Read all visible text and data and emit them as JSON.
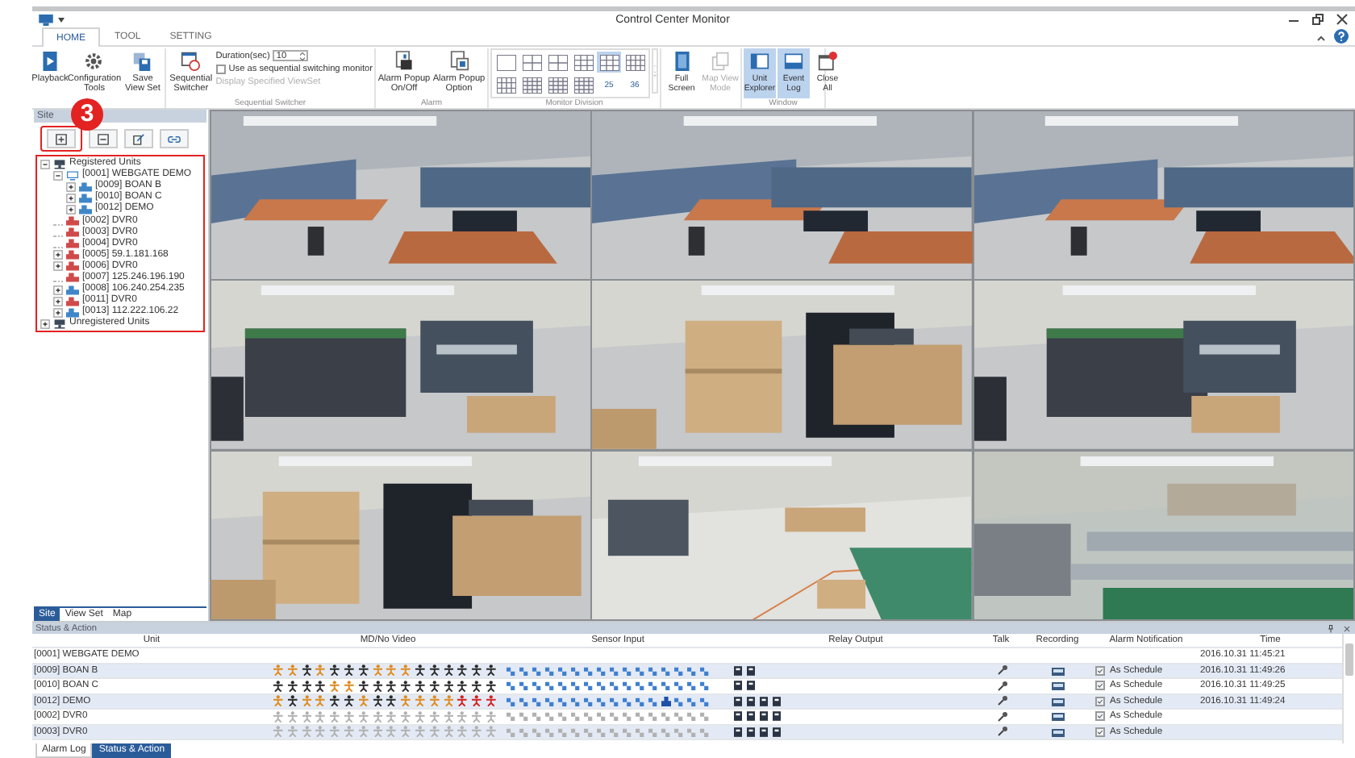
{
  "window": {
    "title": "Control Center Monitor"
  },
  "tabs": [
    {
      "label": "HOME",
      "selected": true
    },
    {
      "label": "TOOL",
      "selected": false
    },
    {
      "label": "SETTING",
      "selected": false
    }
  ],
  "ribbon": {
    "main_buttons": [
      {
        "label": "Playback"
      },
      {
        "label": "Configuration Tools"
      },
      {
        "label": "Save View Set"
      }
    ],
    "sequential": {
      "caption": "Sequential Switcher",
      "button": "Sequential Switcher",
      "duration_label": "Duration(sec)",
      "duration_value": "10",
      "loop_checkbox": {
        "label": "Use as sequential switching monitor",
        "checked": false
      },
      "viewset_option": {
        "label": "Display Specified ViewSet",
        "disabled": true
      }
    },
    "alarm": {
      "caption": "Alarm",
      "buttons": [
        {
          "label": "Alarm Popup On/Off"
        },
        {
          "label": "Alarm Popup Option"
        }
      ]
    },
    "monitor_division": {
      "caption": "Monitor Division",
      "layouts": [
        {
          "selected": false
        },
        {
          "selected": false
        },
        {
          "selected": false
        },
        {
          "selected": false
        },
        {
          "selected": true
        },
        {
          "selected": false
        },
        {
          "selected": false
        },
        {
          "selected": false
        },
        {
          "selected": false
        },
        {
          "selected": false
        },
        {
          "label": "25",
          "selected": false
        },
        {
          "label": "36",
          "selected": false
        }
      ]
    },
    "view_buttons": [
      {
        "label": "Full Screen",
        "disabled": false
      },
      {
        "label": "Map View Mode",
        "disabled": true
      }
    ],
    "window_group": {
      "caption": "Window",
      "buttons": [
        {
          "label": "Unit Explorer",
          "selected": true
        },
        {
          "label": "Event Log",
          "selected": true
        },
        {
          "label": "Close All",
          "selected": false
        }
      ]
    }
  },
  "sidebar": {
    "title": "Site",
    "annotation": "3",
    "tree": [
      {
        "label": "Registered Units",
        "kind": "group",
        "expanded": true,
        "children": [
          {
            "label": "[0001] WEBGATE DEMO",
            "kind": "site",
            "expanded": true,
            "children": [
              {
                "label": "[0009] BOAN B",
                "kind": "unit",
                "color": "#3f86c8",
                "expanded": false
              },
              {
                "label": "[0010] BOAN C",
                "kind": "unit",
                "color": "#3f86c8",
                "expanded": false
              },
              {
                "label": "[0012] DEMO",
                "kind": "unit",
                "color": "#3f86c8",
                "expanded": false
              }
            ]
          },
          {
            "label": "[0002] DVR0",
            "kind": "unit",
            "color": "#d04a4a"
          },
          {
            "label": "[0003] DVR0",
            "kind": "unit",
            "color": "#d04a4a"
          },
          {
            "label": "[0004] DVR0",
            "kind": "unit",
            "color": "#d04a4a"
          },
          {
            "label": "[0005] 59.1.181.168",
            "kind": "unit",
            "color": "#d04a4a",
            "expanded": false
          },
          {
            "label": "[0006] DVR0",
            "kind": "unit",
            "color": "#d04a4a",
            "expanded": false
          },
          {
            "label": "[0007] 125.246.196.190",
            "kind": "unit",
            "color": "#d04a4a"
          },
          {
            "label": "[0008] 106.240.254.235",
            "kind": "unit",
            "color": "#3f86c8",
            "expanded": false
          },
          {
            "label": "[0011] DVR0",
            "kind": "unit",
            "color": "#d04a4a",
            "expanded": false
          },
          {
            "label": "[0013] 112.222.106.22",
            "kind": "unit",
            "color": "#3f86c8",
            "expanded": false
          }
        ]
      },
      {
        "label": "Unregistered Units",
        "kind": "group",
        "expanded": false
      }
    ],
    "tabs": [
      {
        "label": "Site",
        "selected": true
      },
      {
        "label": "View Set",
        "selected": false
      },
      {
        "label": "Map",
        "selected": false
      }
    ]
  },
  "status_panel": {
    "title": "Status & Action",
    "columns": [
      "Unit",
      "MD/No Video",
      "Sensor Input",
      "Relay Output",
      "Talk",
      "Recording",
      "Alarm Notification",
      "Time"
    ],
    "rows": [
      {
        "kind": "site",
        "unit": "[0001] WEBGATE DEMO",
        "time": "2016.10.31 11:45:21"
      },
      {
        "kind": "unit",
        "unit": "[0009] BOAN B",
        "md": [
          {
            "kind": "motion"
          },
          {
            "kind": "motion"
          },
          {
            "kind": "idle"
          },
          {
            "kind": "motion"
          },
          {
            "kind": "idle"
          },
          {
            "kind": "idle"
          },
          {
            "kind": "idle"
          },
          {
            "kind": "motion"
          },
          {
            "kind": "motion"
          },
          {
            "kind": "motion"
          },
          {
            "kind": "idle"
          },
          {
            "kind": "idle"
          },
          {
            "kind": "idle"
          },
          {
            "kind": "idle"
          },
          {
            "kind": "idle"
          },
          {
            "kind": "idle"
          }
        ],
        "sensors": [
          {
            "kind": "normal"
          },
          {
            "kind": "normal"
          },
          {
            "kind": "normal"
          },
          {
            "kind": "normal"
          },
          {
            "kind": "normal"
          },
          {
            "kind": "normal"
          },
          {
            "kind": "normal"
          },
          {
            "kind": "normal"
          },
          {
            "kind": "normal"
          },
          {
            "kind": "normal"
          },
          {
            "kind": "normal"
          },
          {
            "kind": "normal"
          },
          {
            "kind": "normal"
          },
          {
            "kind": "normal"
          },
          {
            "kind": "normal"
          },
          {
            "kind": "normal"
          }
        ],
        "relays": [
          {
            "kind": "normal"
          },
          {
            "kind": "normal"
          }
        ],
        "notification": {
          "checked": true,
          "label": "As Schedule"
        },
        "time": "2016.10.31 11:49:26"
      },
      {
        "kind": "unit",
        "unit": "[0010] BOAN C",
        "md": [
          {
            "kind": "idle"
          },
          {
            "kind": "idle"
          },
          {
            "kind": "idle"
          },
          {
            "kind": "idle"
          },
          {
            "kind": "motion"
          },
          {
            "kind": "motion"
          },
          {
            "kind": "idle"
          },
          {
            "kind": "idle"
          },
          {
            "kind": "idle"
          },
          {
            "kind": "idle"
          },
          {
            "kind": "idle"
          },
          {
            "kind": "idle"
          },
          {
            "kind": "idle"
          },
          {
            "kind": "idle"
          },
          {
            "kind": "idle"
          },
          {
            "kind": "idle"
          }
        ],
        "sensors": [
          {
            "kind": "normal"
          },
          {
            "kind": "normal"
          },
          {
            "kind": "normal"
          },
          {
            "kind": "normal"
          },
          {
            "kind": "normal"
          },
          {
            "kind": "normal"
          },
          {
            "kind": "normal"
          },
          {
            "kind": "normal"
          },
          {
            "kind": "normal"
          },
          {
            "kind": "normal"
          },
          {
            "kind": "normal"
          },
          {
            "kind": "normal"
          },
          {
            "kind": "normal"
          },
          {
            "kind": "normal"
          },
          {
            "kind": "normal"
          },
          {
            "kind": "normal"
          }
        ],
        "relays": [
          {
            "kind": "normal"
          },
          {
            "kind": "normal"
          }
        ],
        "notification": {
          "checked": true,
          "label": "As Schedule"
        },
        "time": "2016.10.31 11:49:25"
      },
      {
        "kind": "unit",
        "unit": "[0012] DEMO",
        "md": [
          {
            "kind": "motion"
          },
          {
            "kind": "idle"
          },
          {
            "kind": "motion"
          },
          {
            "kind": "motion"
          },
          {
            "kind": "idle"
          },
          {
            "kind": "idle"
          },
          {
            "kind": "motion"
          },
          {
            "kind": "idle"
          },
          {
            "kind": "idle"
          },
          {
            "kind": "motion"
          },
          {
            "kind": "motion"
          },
          {
            "kind": "motion"
          },
          {
            "kind": "motion"
          },
          {
            "kind": "no_video"
          },
          {
            "kind": "no_video"
          },
          {
            "kind": "no_video"
          }
        ],
        "sensors": [
          {
            "kind": "normal"
          },
          {
            "kind": "normal"
          },
          {
            "kind": "normal"
          },
          {
            "kind": "normal"
          },
          {
            "kind": "normal"
          },
          {
            "kind": "normal"
          },
          {
            "kind": "normal"
          },
          {
            "kind": "normal"
          },
          {
            "kind": "normal"
          },
          {
            "kind": "normal"
          },
          {
            "kind": "normal"
          },
          {
            "kind": "normal"
          },
          {
            "kind": "alarm"
          },
          {
            "kind": "normal"
          },
          {
            "kind": "normal"
          },
          {
            "kind": "normal"
          }
        ],
        "relays": [
          {
            "kind": "normal"
          },
          {
            "kind": "normal"
          },
          {
            "kind": "normal"
          },
          {
            "kind": "normal"
          }
        ],
        "notification": {
          "checked": true,
          "label": "As Schedule"
        },
        "time": "2016.10.31 11:49:24"
      },
      {
        "kind": "unit",
        "unit": "[0002] DVR0",
        "md": [
          {
            "kind": "offline"
          },
          {
            "kind": "offline"
          },
          {
            "kind": "offline"
          },
          {
            "kind": "offline"
          },
          {
            "kind": "offline"
          },
          {
            "kind": "offline"
          },
          {
            "kind": "offline"
          },
          {
            "kind": "offline"
          },
          {
            "kind": "offline"
          },
          {
            "kind": "offline"
          },
          {
            "kind": "offline"
          },
          {
            "kind": "offline"
          },
          {
            "kind": "offline"
          },
          {
            "kind": "offline"
          },
          {
            "kind": "offline"
          },
          {
            "kind": "offline"
          }
        ],
        "sensors": [
          {
            "kind": "offline"
          },
          {
            "kind": "offline"
          },
          {
            "kind": "offline"
          },
          {
            "kind": "offline"
          },
          {
            "kind": "offline"
          },
          {
            "kind": "offline"
          },
          {
            "kind": "offline"
          },
          {
            "kind": "offline"
          },
          {
            "kind": "offline"
          },
          {
            "kind": "offline"
          },
          {
            "kind": "offline"
          },
          {
            "kind": "offline"
          },
          {
            "kind": "offline"
          },
          {
            "kind": "offline"
          },
          {
            "kind": "offline"
          },
          {
            "kind": "offline"
          }
        ],
        "relays": [
          {
            "kind": "normal"
          },
          {
            "kind": "normal"
          },
          {
            "kind": "normal"
          },
          {
            "kind": "normal"
          }
        ],
        "notification": {
          "checked": true,
          "label": "As Schedule"
        }
      },
      {
        "kind": "unit",
        "unit": "[0003] DVR0",
        "md": [
          {
            "kind": "offline"
          },
          {
            "kind": "offline"
          },
          {
            "kind": "offline"
          },
          {
            "kind": "offline"
          },
          {
            "kind": "offline"
          },
          {
            "kind": "offline"
          },
          {
            "kind": "offline"
          },
          {
            "kind": "offline"
          },
          {
            "kind": "offline"
          },
          {
            "kind": "offline"
          },
          {
            "kind": "offline"
          },
          {
            "kind": "offline"
          },
          {
            "kind": "offline"
          },
          {
            "kind": "offline"
          },
          {
            "kind": "offline"
          },
          {
            "kind": "offline"
          }
        ],
        "sensors": [
          {
            "kind": "offline"
          },
          {
            "kind": "offline"
          },
          {
            "kind": "offline"
          },
          {
            "kind": "offline"
          },
          {
            "kind": "offline"
          },
          {
            "kind": "offline"
          },
          {
            "kind": "offline"
          },
          {
            "kind": "offline"
          },
          {
            "kind": "offline"
          },
          {
            "kind": "offline"
          },
          {
            "kind": "offline"
          },
          {
            "kind": "offline"
          },
          {
            "kind": "offline"
          },
          {
            "kind": "offline"
          },
          {
            "kind": "offline"
          },
          {
            "kind": "offline"
          }
        ],
        "relays": [
          {
            "kind": "normal"
          },
          {
            "kind": "normal"
          },
          {
            "kind": "normal"
          },
          {
            "kind": "normal"
          }
        ],
        "notification": {
          "checked": true,
          "label": "As Schedule"
        }
      }
    ]
  },
  "bottom_tabs": [
    {
      "label": "Alarm Log",
      "selected": false
    },
    {
      "label": "Status & Action",
      "selected": true
    }
  ]
}
